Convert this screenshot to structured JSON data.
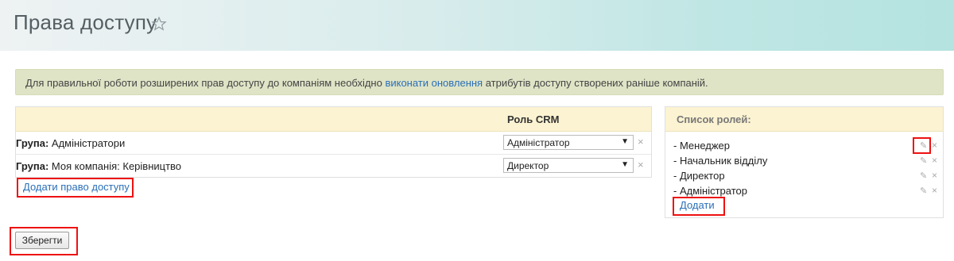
{
  "header": {
    "title": "Права доступу",
    "star_icon": "star-outline-icon"
  },
  "alert": {
    "text_before": "Для правильної роботи розширених прав доступу до компаніям необхідно ",
    "link": "виконати оновлення",
    "text_after": " атрибутів доступу створених раніше компаній."
  },
  "access_table": {
    "role_column": "Роль CRM",
    "rows": [
      {
        "label_bold": "Група:",
        "label": " Адміністратори",
        "role": "Адміністратор",
        "remove": "×"
      },
      {
        "label_bold": "Група:",
        "label": " Моя компанія: Керівництво",
        "role": "Директор",
        "remove": "×"
      }
    ],
    "add_link": "Додати право доступу"
  },
  "save_button": "Зберегти",
  "roles_panel": {
    "title": "Список ролей:",
    "roles": [
      {
        "name": "- Менеджер"
      },
      {
        "name": "- Начальник відділу"
      },
      {
        "name": "- Директор"
      },
      {
        "name": "- Адміністратор"
      }
    ],
    "edit_icon": "pencil-icon",
    "delete_glyph": "×",
    "add_link": "Додати"
  },
  "colors": {
    "link": "#2a6fb7",
    "highlight": "#e11111",
    "table_header": "#fcf3d2",
    "alert_bg": "#dfe4c6"
  }
}
